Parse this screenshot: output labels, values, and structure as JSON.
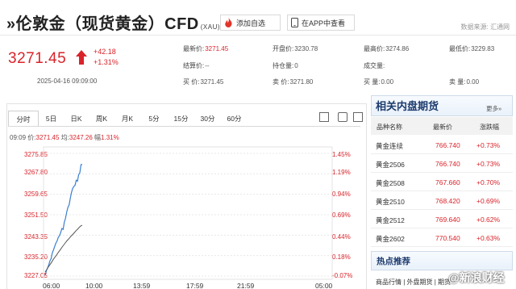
{
  "header": {
    "title": "»伦敦金（现货黄金）CFD",
    "title_code": "(XAU)",
    "watch_label": "添加自选",
    "app_label": "在APP中查看",
    "source": "数据来源: 汇通网"
  },
  "quote": {
    "price": "3271.45",
    "change": "+42.18",
    "change_pct": "+1.31%",
    "datetime": "2025-04-16 09:09:00",
    "fields": {
      "last_label": "最新价:",
      "last": "3271.45",
      "open_label": "开盘价:",
      "open": "3230.78",
      "high_label": "最高价:",
      "high": "3274.86",
      "low_label": "最低价:",
      "low": "3229.83",
      "settle_label": "结算价:",
      "settle": "--",
      "oi_label": "持仓量:",
      "oi": "0",
      "vol_label": "成交量:",
      "vol": "",
      "buy_label": "买  价:",
      "buy": "3271.45",
      "sell_label": "卖  价:",
      "sell": "3271.80",
      "bidvol_label": "买  量:",
      "bidvol": "0.00",
      "askvol_label": "卖  量:",
      "askvol": "0.00"
    }
  },
  "chart_tabs": [
    "分时",
    "5日",
    "日K",
    "周K",
    "月K",
    "5分",
    "15分",
    "30分",
    "60分"
  ],
  "chart_info": {
    "time": "09:09",
    "price_label": "价:",
    "price": "3271.45",
    "avg_label": "均:",
    "avg": "3247.26",
    "pct_label": "幅",
    "pct": "1.31%"
  },
  "chart_data": {
    "type": "line",
    "title": "",
    "x_ticks": [
      "06:00",
      "10:00",
      "13:59",
      "17:59",
      "21:59",
      "05:00"
    ],
    "y_ticks": [
      "3275.85",
      "3267.80",
      "3259.65",
      "3251.50",
      "3243.35",
      "3235.20",
      "3227.05"
    ],
    "y_right_ticks": [
      "1.45%",
      "1.19%",
      "0.94%",
      "0.69%",
      "0.44%",
      "0.18%",
      "-0.07%"
    ],
    "ylim": [
      3227.05,
      3275.85
    ],
    "series": [
      {
        "values": [
          3227.4,
          3229.2,
          3230.3,
          3231.5,
          3233.1,
          3234.0,
          3236.3,
          3237.5,
          3238.9,
          3240.2,
          3241.0,
          3242.5,
          3243.1,
          3244.4,
          3246.0,
          3245.6,
          3248.4,
          3250.0,
          3252.4,
          3254.4,
          3255.3,
          3258.0,
          3260.2,
          3261.9,
          3262.7,
          3263.2,
          3265.2,
          3264.8,
          3267.3,
          3268.1,
          3271.4,
          3271.45
        ]
      },
      {
        "values": [
          3228.7,
          3229.6,
          3230.6,
          3231.5,
          3232.4,
          3233.4,
          3234.3,
          3235.1,
          3236.0,
          3236.9,
          3237.7,
          3238.6,
          3239.4,
          3240.2,
          3241.0,
          3241.7,
          3242.4,
          3243.1,
          3243.7,
          3244.4,
          3245.1,
          3245.7,
          3246.4,
          3247.0,
          3247.26
        ]
      }
    ]
  },
  "sidebar": {
    "title": "相关内盘期货",
    "more": "更多»",
    "cols": [
      "品种名称",
      "最新价",
      "涨跌幅"
    ],
    "rows": [
      {
        "name": "黄金连续",
        "price": "766.740",
        "chg": "+0.73%"
      },
      {
        "name": "黄金2506",
        "price": "766.740",
        "chg": "+0.73%"
      },
      {
        "name": "黄金2508",
        "price": "767.660",
        "chg": "+0.70%"
      },
      {
        "name": "黄金2510",
        "price": "768.420",
        "chg": "+0.69%"
      },
      {
        "name": "黄金2512",
        "price": "769.640",
        "chg": "+0.62%"
      },
      {
        "name": "黄金2602",
        "price": "770.540",
        "chg": "+0.63%"
      }
    ],
    "hot_title": "热点推荐",
    "hot_text": "商品行情 | 外盘期货 | 期货"
  },
  "watermark": "@新浪财经",
  "colors": {
    "up": "#d9232a",
    "line": "#3a7fd0",
    "avg": "#555555"
  }
}
